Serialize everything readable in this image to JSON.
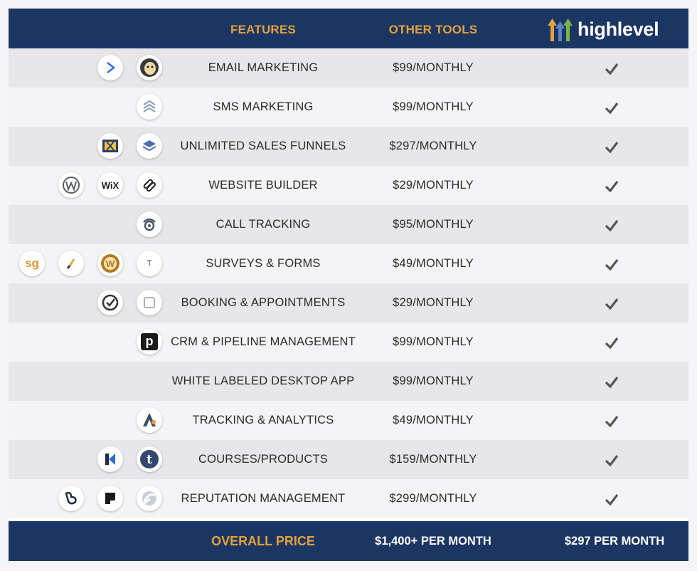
{
  "header": {
    "features_label": "FEATURES",
    "other_tools_label": "OTHER TOOLS",
    "brand_name": "highlevel"
  },
  "colors": {
    "navy": "#1c3664",
    "gold": "#e3a23a",
    "row_dark": "#e7e7ea",
    "row_light": "#f4f4f6",
    "check": "#555555"
  },
  "rows": [
    {
      "feature": "EMAIL MARKETING",
      "price": "$99/MONTHLY",
      "highlevel": "check-icon",
      "tool_icons": [
        "activecampaign-icon",
        "mailchimp-icon"
      ]
    },
    {
      "feature": "SMS MARKETING",
      "price": "$99/MONTHLY",
      "highlevel": "check-icon",
      "tool_icons": [
        "sms-chevrons-icon"
      ]
    },
    {
      "feature": "UNLIMITED SALES FUNNELS",
      "price": "$297/MONTHLY",
      "highlevel": "check-icon",
      "tool_icons": [
        "funnel-x-icon",
        "layers-icon"
      ]
    },
    {
      "feature": "WEBSITE BUILDER",
      "price": "$29/MONTHLY",
      "highlevel": "check-icon",
      "tool_icons": [
        "wordpress-icon",
        "wix-icon",
        "squarespace-icon"
      ]
    },
    {
      "feature": "CALL TRACKING",
      "price": "$95/MONTHLY",
      "highlevel": "check-icon",
      "tool_icons": [
        "callrail-icon"
      ]
    },
    {
      "feature": "SURVEYS & FORMS",
      "price": "$49/MONTHLY",
      "highlevel": "check-icon",
      "tool_icons": [
        "surveygizmo-icon",
        "jotform-icon",
        "wufoo-icon",
        "typeform-icon"
      ]
    },
    {
      "feature": "BOOKING & APPOINTMENTS",
      "price": "$29/MONTHLY",
      "highlevel": "check-icon",
      "tool_icons": [
        "acuity-icon",
        "calendly-icon"
      ]
    },
    {
      "feature": "CRM & PIPELINE MANAGEMENT",
      "price": "$99/MONTHLY",
      "highlevel": "check-icon",
      "tool_icons": [
        "pipedrive-icon"
      ]
    },
    {
      "feature": "WHITE LABELED DESKTOP APP",
      "price": "$99/MONTHLY",
      "highlevel": "check-icon",
      "tool_icons": []
    },
    {
      "feature": "TRACKING & ANALYTICS",
      "price": "$49/MONTHLY",
      "highlevel": "check-icon",
      "tool_icons": [
        "analytics-a-icon"
      ]
    },
    {
      "feature": "COURSES/PRODUCTS",
      "price": "$159/MONTHLY",
      "highlevel": "check-icon",
      "tool_icons": [
        "kajabi-icon",
        "teachable-icon"
      ]
    },
    {
      "feature": "REPUTATION MANAGEMENT",
      "price": "$299/MONTHLY",
      "highlevel": "check-icon",
      "tool_icons": [
        "birdeye-icon",
        "podium-icon",
        "grade-us-icon"
      ]
    }
  ],
  "icon_glyphs": {
    "wix": "WiX",
    "typeform": "T",
    "surveygizmo": "sg",
    "pipedrive": "p"
  },
  "footer": {
    "label": "OVERALL PRICE",
    "other_total": "$1,400+ PER MONTH",
    "highlevel_total": "$297 PER MONTH"
  }
}
